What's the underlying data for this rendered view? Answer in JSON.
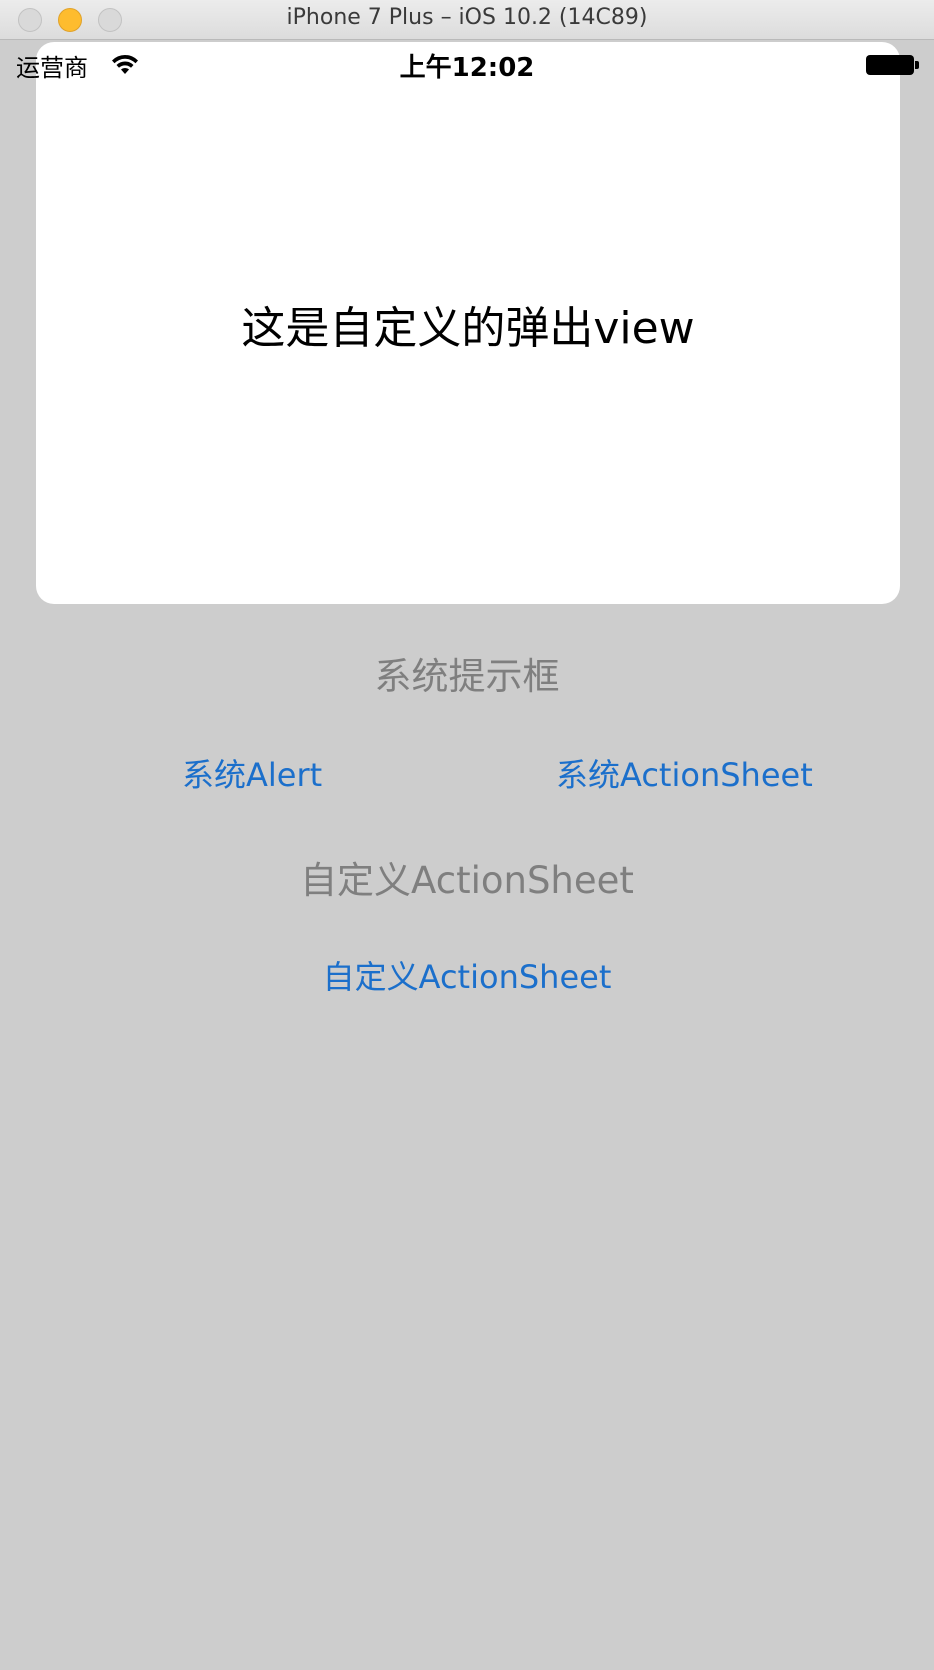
{
  "window": {
    "title": "iPhone 7 Plus – iOS 10.2 (14C89)"
  },
  "statusbar": {
    "carrier": "运营商",
    "time": "上午12:02",
    "wifi_icon": "wifi-icon",
    "battery_icon": "battery-icon"
  },
  "popup": {
    "text": "这是自定义的弹出view"
  },
  "sections": {
    "system_title": "系统提示框",
    "system_alert_label": "系统Alert",
    "system_actionsheet_label": "系统ActionSheet",
    "custom_title": "自定义ActionSheet",
    "custom_actionsheet_label": "自定义ActionSheet"
  },
  "colors": {
    "background": "#cdcdcd",
    "link": "#1b6fcb",
    "section_label": "#7f7f7f",
    "popup": "#ffffff"
  }
}
